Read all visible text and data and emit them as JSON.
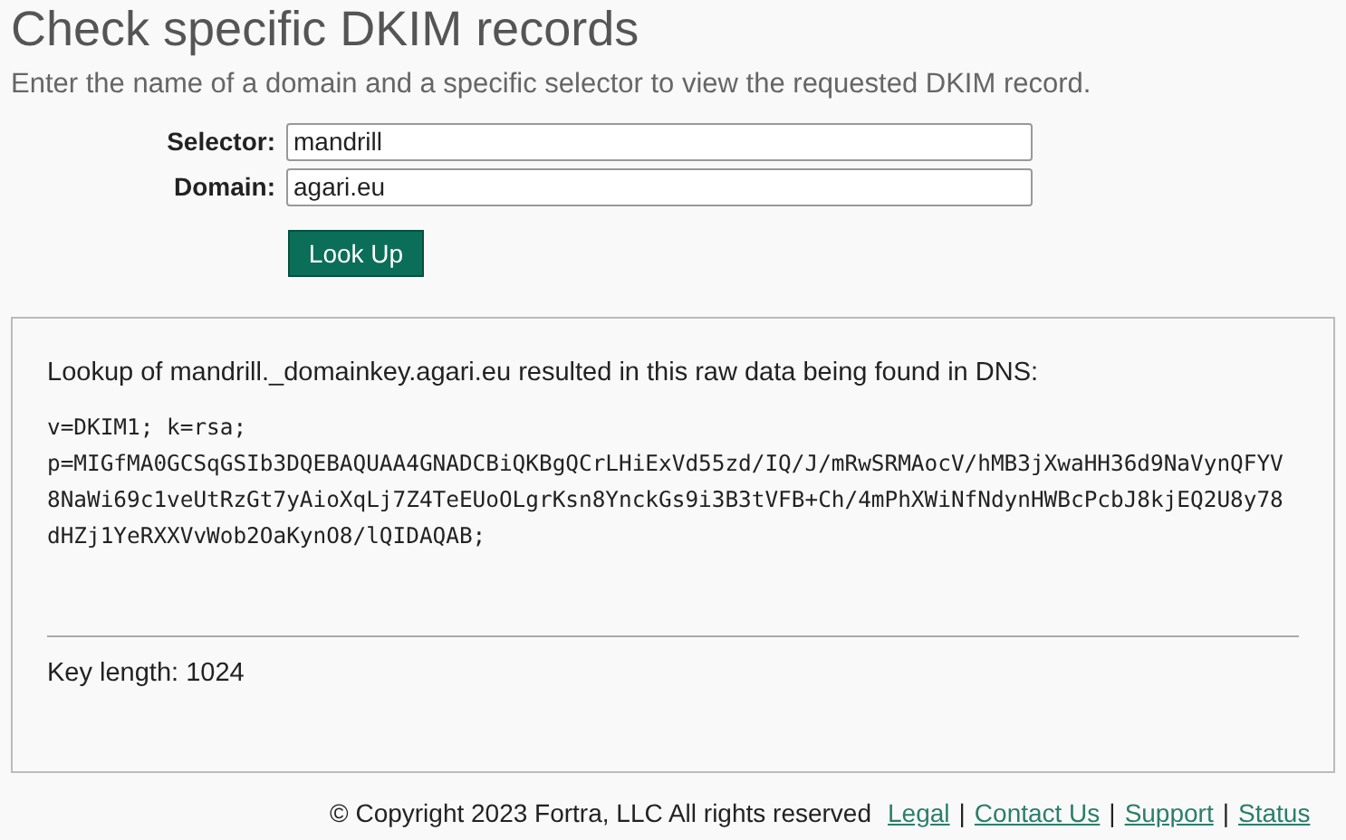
{
  "title": "Check specific DKIM records",
  "subtitle": "Enter the name of a domain and a specific selector to view the requested DKIM record.",
  "form": {
    "fields": [
      {
        "label": "Selector:",
        "value": "mandrill"
      },
      {
        "label": "Domain:",
        "value": "agari.eu"
      }
    ],
    "button": "Look Up"
  },
  "result": {
    "intro": "Lookup of mandrill._domainkey.agari.eu resulted in this raw data being found in DNS:",
    "record_lines": [
      "v=DKIM1; k=rsa;",
      "p=MIGfMA0GCSqGSIb3DQEBAQUAA4GNADCBiQKBgQCrLHiExVd55zd/IQ/J/mRwSRMAocV/hMB3jXwaHH36d9NaVynQFYV",
      "8NaWi69c1veUtRzGt7yAioXqLj7Z4TeEUoOLgrKsn8YnckGs9i3B3tVFB+Ch/4mPhXWiNfNdynHWBcPcbJ8kjEQ2U8y78",
      "dHZj1YeRXXVvWob2OaKynO8/lQIDAQAB;"
    ],
    "key_length": "Key length: 1024"
  },
  "footer": {
    "copyright": "© Copyright 2023 Fortra, LLC All rights reserved",
    "links": [
      {
        "label": "Legal"
      },
      {
        "label": "Contact Us"
      },
      {
        "label": "Support"
      },
      {
        "label": "Status"
      }
    ],
    "separator": "|"
  }
}
